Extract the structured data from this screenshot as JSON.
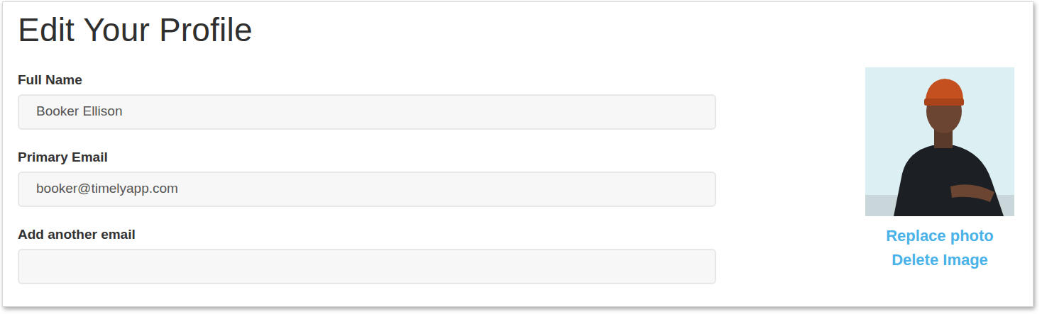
{
  "page": {
    "title": "Edit Your Profile"
  },
  "fields": [
    {
      "label": "Full Name",
      "value": "Booker Ellison"
    },
    {
      "label": "Primary Email",
      "value": "booker@timelyapp.com"
    },
    {
      "label": "Add another email",
      "value": ""
    }
  ],
  "photo": {
    "actions": [
      "Replace photo",
      "Delete Image"
    ]
  }
}
